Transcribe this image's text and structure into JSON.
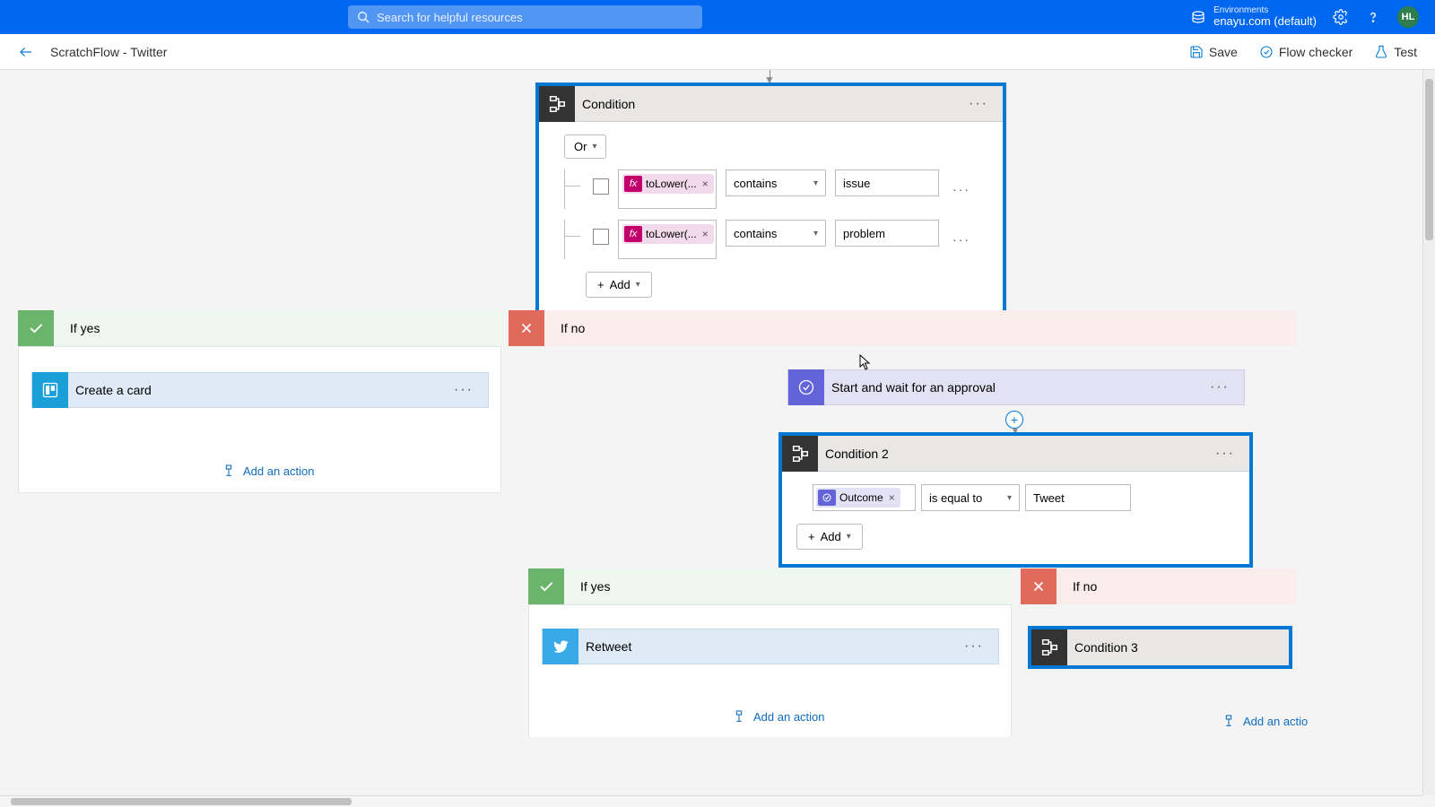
{
  "top": {
    "search_placeholder": "Search for helpful resources",
    "env_label": "Environments",
    "env_value": "enayu.com (default)",
    "avatar": "HL"
  },
  "toolbar": {
    "title": "ScratchFlow - Twitter",
    "save": "Save",
    "checker": "Flow checker",
    "test": "Test"
  },
  "cond1": {
    "title": "Condition",
    "combinator": "Or",
    "row1_token": "toLower(...",
    "row1_op": "contains",
    "row1_val": "issue",
    "row2_token": "toLower(...",
    "row2_op": "contains",
    "row2_val": "problem",
    "add": "Add"
  },
  "branch": {
    "yes": "If yes",
    "no": "If no",
    "trello": "Create a card",
    "add_action": "Add an action",
    "approval": "Start and wait for an approval"
  },
  "cond2": {
    "title": "Condition 2",
    "token": "Outcome",
    "op": "is equal to",
    "val": "Tweet",
    "add": "Add"
  },
  "branch2": {
    "yes": "If yes",
    "no": "If no",
    "retweet": "Retweet",
    "cond3": "Condition 3",
    "add_action": "Add an action",
    "add_action_trunc": "Add an actio"
  }
}
